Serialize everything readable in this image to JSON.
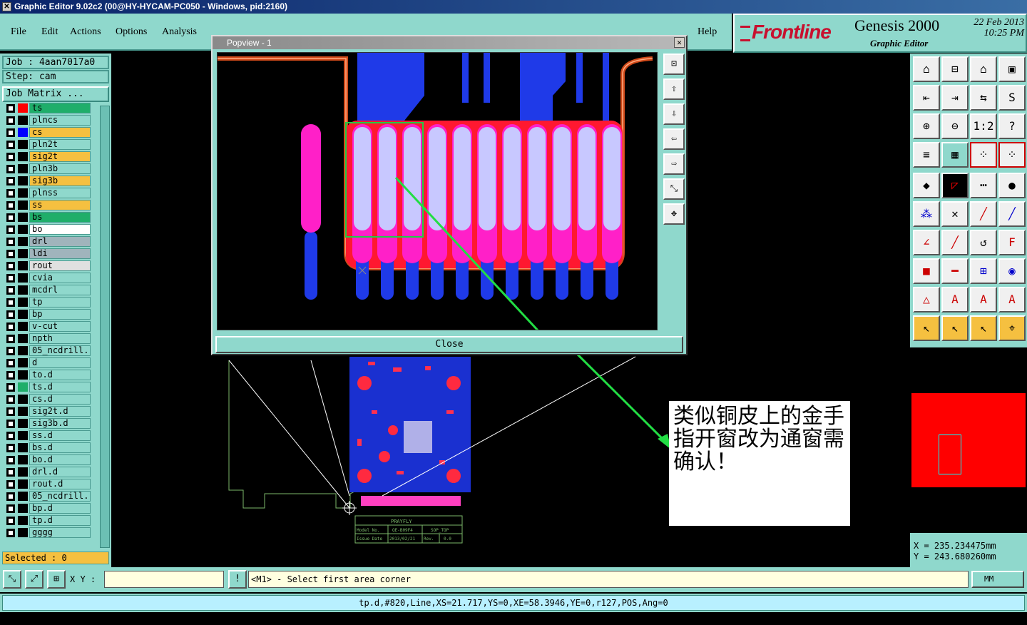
{
  "window": {
    "title": "Graphic Editor 9.02c2 (00@HY-HYCAM-PC050 - Windows, pid:2160)"
  },
  "menu": [
    {
      "label": "File"
    },
    {
      "label": "Edit"
    },
    {
      "label": "Actions"
    },
    {
      "label": "Options"
    },
    {
      "label": "Analysis"
    },
    {
      "label": "Help"
    }
  ],
  "brand": {
    "logo": "Frontline",
    "product": "Genesis 2000",
    "subtitle": "Graphic Editor",
    "date": "22 Feb 2013",
    "time": "10:25 PM"
  },
  "job": {
    "job_label": "Job : 4aan7017a0",
    "step_label": "Step: cam",
    "matrix_button": "Job Matrix ..."
  },
  "layers": [
    {
      "name": "ts",
      "color": "#ff0000",
      "bg": "#1fae6a"
    },
    {
      "name": "plncs",
      "color": "#000000",
      "bg": "#8fd8cc"
    },
    {
      "name": "cs",
      "color": "#0000ff",
      "bg": "#f5c040"
    },
    {
      "name": "pln2t",
      "color": "#000000",
      "bg": "#8fd8cc"
    },
    {
      "name": "sig2t",
      "color": "#000000",
      "bg": "#f5c040"
    },
    {
      "name": "pln3b",
      "color": "#000000",
      "bg": "#8fd8cc"
    },
    {
      "name": "sig3b",
      "color": "#000000",
      "bg": "#f5c040"
    },
    {
      "name": "plnss",
      "color": "#000000",
      "bg": "#8fd8cc"
    },
    {
      "name": "ss",
      "color": "#000000",
      "bg": "#f5c040"
    },
    {
      "name": "bs",
      "color": "#000000",
      "bg": "#1fae6a"
    },
    {
      "name": "bo",
      "color": "#000000",
      "bg": "#ffffff"
    },
    {
      "name": "drl",
      "color": "#000000",
      "bg": "#a0b4bc"
    },
    {
      "name": "ldi",
      "color": "#000000",
      "bg": "#a0b4bc"
    },
    {
      "name": "rout",
      "color": "#000000",
      "bg": "#e0e0e0"
    },
    {
      "name": "cvia",
      "color": "#000000",
      "bg": "#8fd8cc"
    },
    {
      "name": "mcdrl",
      "color": "#000000",
      "bg": "#8fd8cc"
    },
    {
      "name": "tp",
      "color": "#000000",
      "bg": "#8fd8cc"
    },
    {
      "name": "bp",
      "color": "#000000",
      "bg": "#8fd8cc"
    },
    {
      "name": "v-cut",
      "color": "#000000",
      "bg": "#8fd8cc"
    },
    {
      "name": "npth",
      "color": "#000000",
      "bg": "#8fd8cc"
    },
    {
      "name": "05_ncdrill.",
      "color": "#000000",
      "bg": "#8fd8cc"
    },
    {
      "name": "d",
      "color": "#000000",
      "bg": "#8fd8cc"
    },
    {
      "name": "to.d",
      "color": "#000000",
      "bg": "#8fd8cc"
    },
    {
      "name": "ts.d",
      "color": "#1fae6a",
      "bg": "#8fd8cc"
    },
    {
      "name": "cs.d",
      "color": "#000000",
      "bg": "#8fd8cc"
    },
    {
      "name": "sig2t.d",
      "color": "#000000",
      "bg": "#8fd8cc"
    },
    {
      "name": "sig3b.d",
      "color": "#000000",
      "bg": "#8fd8cc"
    },
    {
      "name": "ss.d",
      "color": "#000000",
      "bg": "#8fd8cc"
    },
    {
      "name": "bs.d",
      "color": "#000000",
      "bg": "#8fd8cc"
    },
    {
      "name": "bo.d",
      "color": "#000000",
      "bg": "#8fd8cc"
    },
    {
      "name": "drl.d",
      "color": "#000000",
      "bg": "#8fd8cc"
    },
    {
      "name": "rout.d",
      "color": "#000000",
      "bg": "#8fd8cc"
    },
    {
      "name": "05_ncdrill.",
      "color": "#000000",
      "bg": "#8fd8cc"
    },
    {
      "name": "bp.d",
      "color": "#000000",
      "bg": "#8fd8cc"
    },
    {
      "name": "tp.d",
      "color": "#000000",
      "bg": "#8fd8cc"
    },
    {
      "name": "gggg",
      "color": "#000000",
      "bg": "#8fd8cc"
    }
  ],
  "selected": "Selected : 0",
  "popview": {
    "title": "Popview - 1",
    "close_button": "Close"
  },
  "annotation": "类似铜皮上的金手指开窗改为通窗需确认！",
  "titleblock": {
    "company": "PRAYFLY",
    "model_label": "Model No.",
    "model_value": "QE-B09F4",
    "side": "SOP_TOP",
    "issue_label": "Issue Date",
    "issue_value": "2013/02/21",
    "rev_label": "Rev.",
    "rev_value": "0.0"
  },
  "right_tools": {
    "one_to_two": "1:2",
    "help": "?"
  },
  "coordinates": {
    "x": "X = 235.234475mm",
    "y": "Y = 243.680260mm"
  },
  "bottom": {
    "xy_label": "X Y :",
    "xy_value": "",
    "prompt": "<M1> - Select first area corner",
    "units": "MM"
  },
  "status": "tp.d,#820,Line,XS=21.717,YS=0,XE=58.3946,YE=0,r127,POS,Ang=0",
  "colors": {
    "panel": "#8fd8cc",
    "highlight": "#f5c040",
    "copper": "#0000ff",
    "mask": "#ff0000"
  }
}
